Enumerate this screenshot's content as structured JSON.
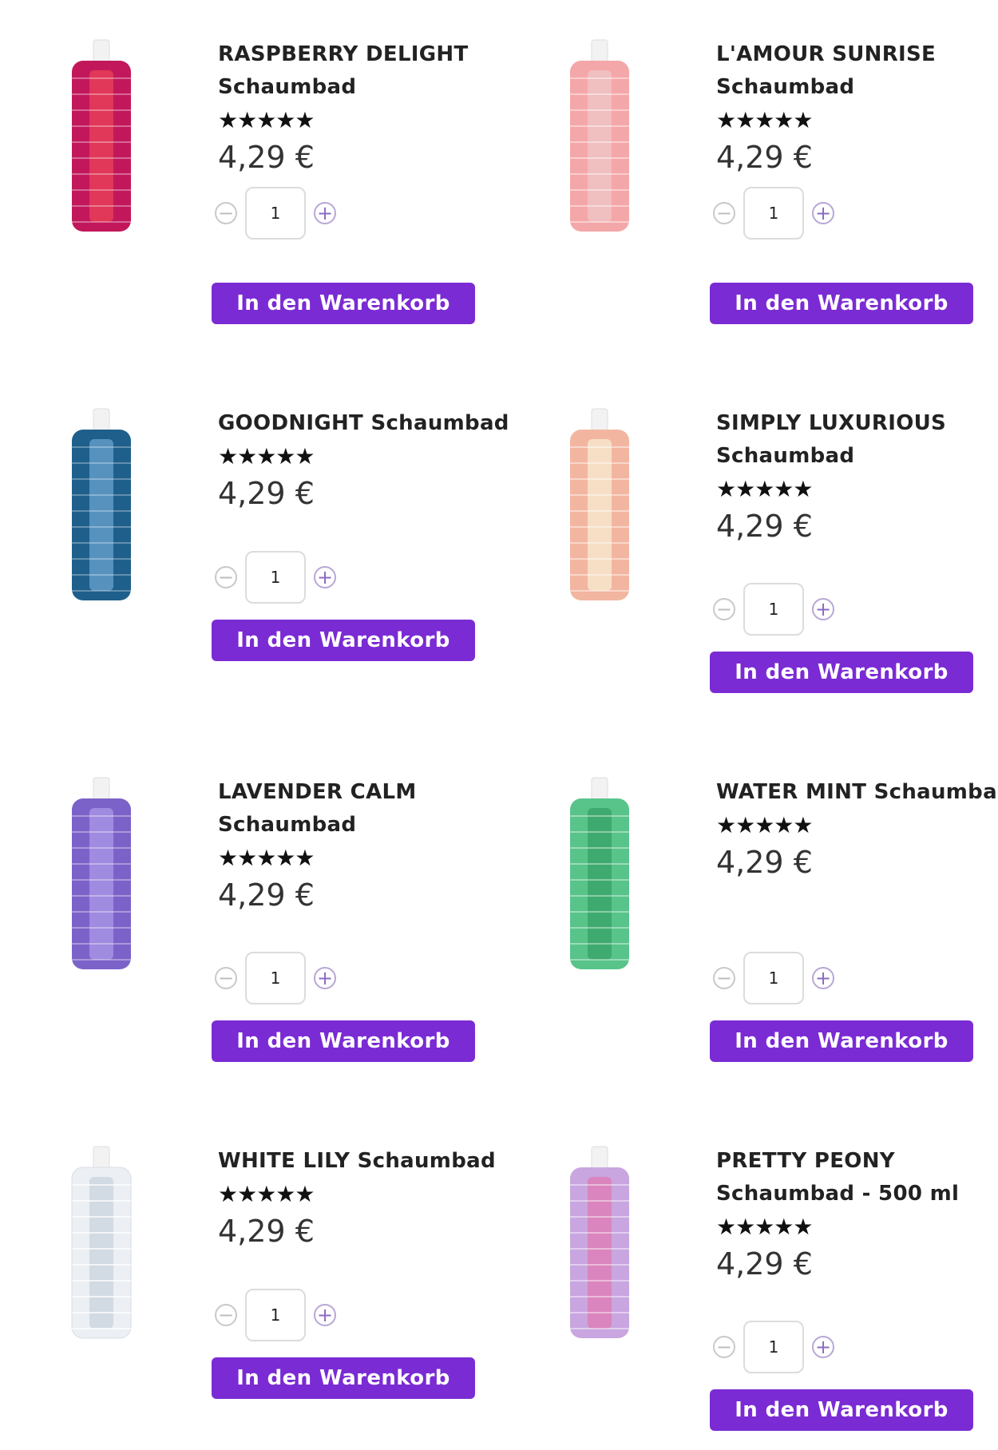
{
  "products": [
    {
      "title": "RASPBERRY DELIGHT Schaumbad",
      "rating": "★★★★★",
      "price": "4,29 €",
      "qty": "1",
      "cart_label": "In den Warenkorb",
      "minus": "−",
      "plus": "+",
      "color": "#c2185b",
      "accent": "#e94057"
    },
    {
      "title": "L'AMOUR SUNRISE Schaumbad",
      "rating": "★★★★★",
      "price": "4,29 €",
      "qty": "1",
      "cart_label": "In den Warenkorb",
      "minus": "−",
      "plus": "+",
      "color": "#f4a7a8",
      "accent": "#f0c2c2"
    },
    {
      "title": "GOODNIGHT Schaumbad",
      "rating": "★★★★★",
      "price": "4,29 €",
      "qty": "1",
      "cart_label": "In den Warenkorb",
      "minus": "−",
      "plus": "+",
      "color": "#1f5f8b",
      "accent": "#6fa8d6"
    },
    {
      "title": "SIMPLY LUXURIOUS Schaumbad",
      "rating": "★★★★★",
      "price": "4,29 €",
      "qty": "1",
      "cart_label": "In den Warenkorb",
      "minus": "−",
      "plus": "+",
      "color": "#f2b6a0",
      "accent": "#f7e2c8"
    },
    {
      "title": "LAVENDER CALM Schaumbad",
      "rating": "★★★★★",
      "price": "4,29 €",
      "qty": "1",
      "cart_label": "In den Warenkorb",
      "minus": "−",
      "plus": "+",
      "color": "#7b62c8",
      "accent": "#a996e6"
    },
    {
      "title": "WATER MINT Schaumbad",
      "rating": "★★★★★",
      "price": "4,29 €",
      "qty": "1",
      "cart_label": "In den Warenkorb",
      "minus": "−",
      "plus": "+",
      "color": "#58c48a",
      "accent": "#2e9a5e"
    },
    {
      "title": "WHITE LILY Schaumbad",
      "rating": "★★★★★",
      "price": "4,29 €",
      "qty": "1",
      "cart_label": "In den Warenkorb",
      "minus": "−",
      "plus": "+",
      "color": "#eceff3",
      "accent": "#c8d2dc"
    },
    {
      "title": "PRETTY PEONY Schaumbad - 500 ml",
      "rating": "★★★★★",
      "price": "4,29 €",
      "qty": "1",
      "cart_label": "In den Warenkorb",
      "minus": "−",
      "plus": "+",
      "color": "#c9a6e0",
      "accent": "#e86aa0"
    }
  ]
}
